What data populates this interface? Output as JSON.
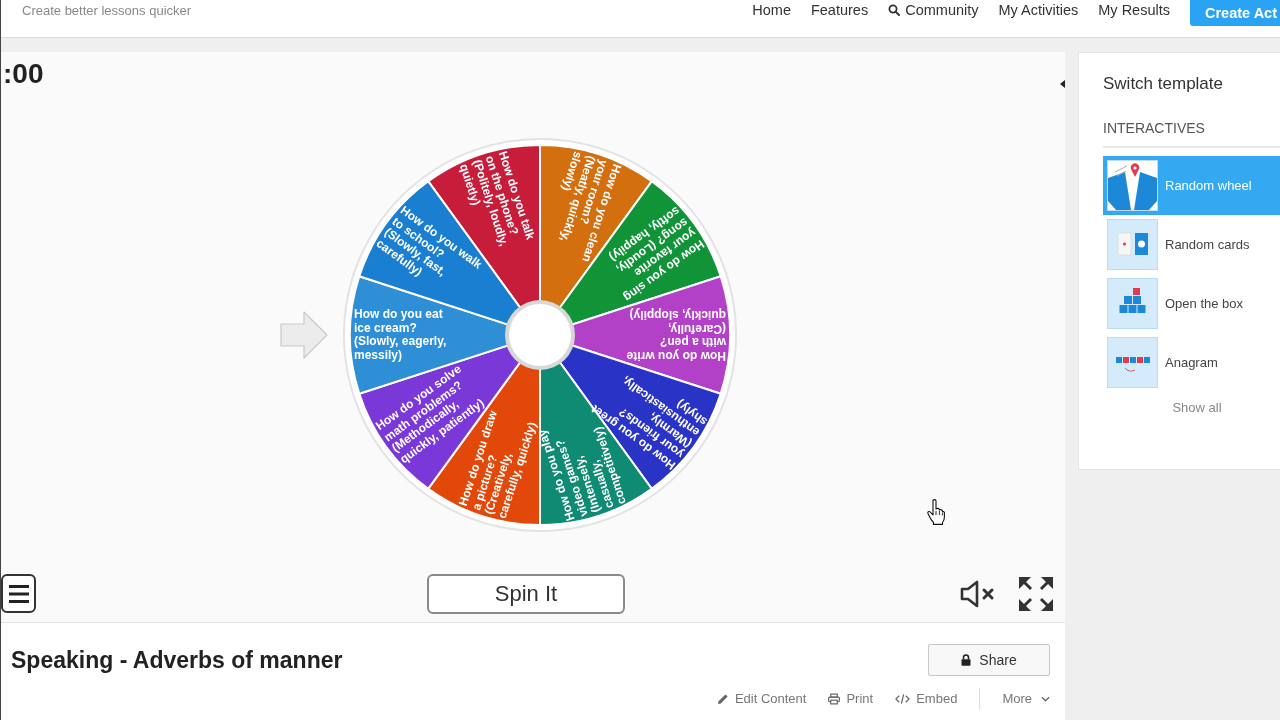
{
  "header": {
    "tagline": "Create better lessons quicker",
    "nav": [
      {
        "label": "Home",
        "kind": "plain"
      },
      {
        "label": "Features",
        "kind": "plain"
      },
      {
        "label": "Community",
        "kind": "search"
      },
      {
        "label": "My Activities",
        "kind": "plain"
      },
      {
        "label": "My Results",
        "kind": "plain"
      }
    ],
    "create_button": "Create Act"
  },
  "activity": {
    "timer": ":00",
    "wheel": {
      "segments": [
        {
          "text": "How do you talk on the phone? (Politely, loudly, quietly)",
          "color": "#c81d3a"
        },
        {
          "text": "How do you clean your room? (Neatly, quickly, slowly)",
          "color": "#d46f0f"
        },
        {
          "text": "How do you sing your favorite song? (Loudly, softly, happily)",
          "color": "#119438"
        },
        {
          "text": "How do you write with a pen? (Carefully, quickly, sloppily)",
          "color": "#b241c8"
        },
        {
          "text": "How do you greet your friends? (Warmly, enthusiastically, shyly)",
          "color": "#2934c7"
        },
        {
          "text": "How do you play video games? (Intensely, casually, competitively)",
          "color": "#0f8a73"
        },
        {
          "text": "How do you draw a picture? (Creatively, carefully, quickly)",
          "color": "#e2480a"
        },
        {
          "text": "How do you solve math problems? (Methodically, quickly, patiently)",
          "color": "#7b38d8"
        },
        {
          "text": "How do you eat ice cream? (Slowly, eagerly, messily)",
          "color": "#2e8fd6"
        },
        {
          "text": "How do you walk to school? (Slowly, fast, carefully)",
          "color": "#1b7fd1"
        }
      ]
    },
    "spin_button": "Spin It",
    "muted": true
  },
  "info": {
    "title": "Speaking - Adverbs of manner",
    "share_button": "Share",
    "actions": [
      {
        "label": "Edit Content",
        "kind": "edit"
      },
      {
        "label": "Print",
        "kind": "print"
      },
      {
        "label": "Embed",
        "kind": "embed"
      },
      {
        "label": "More",
        "kind": "more"
      }
    ]
  },
  "sidebar": {
    "title": "Switch template",
    "section": "INTERACTIVES",
    "templates": [
      {
        "label": "Random wheel",
        "kind": "wheel",
        "selected": true
      },
      {
        "label": "Random cards",
        "kind": "cards",
        "selected": false
      },
      {
        "label": "Open the box",
        "kind": "box",
        "selected": false
      },
      {
        "label": "Anagram",
        "kind": "anagram",
        "selected": false
      }
    ],
    "show_all": "Show all"
  }
}
